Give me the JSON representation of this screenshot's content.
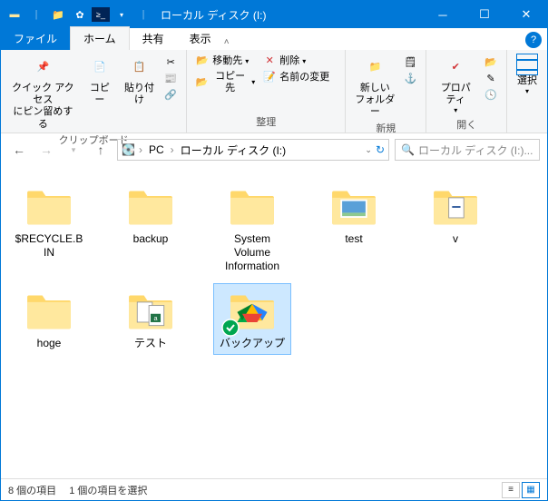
{
  "titlebar": {
    "title": "ローカル ディスク (I:)"
  },
  "tabs": {
    "file": "ファイル",
    "home": "ホーム",
    "share": "共有",
    "view": "表示"
  },
  "ribbon": {
    "clipboard": {
      "pin": "クイック アクセス\nにピン留めする",
      "copy": "コピー",
      "paste": "貼り付け",
      "label": "クリップボード"
    },
    "organize": {
      "moveto": "移動先",
      "copyto": "コピー先",
      "delete": "削除",
      "rename": "名前の変更",
      "label": "整理"
    },
    "new": {
      "newfolder": "新しい\nフォルダー",
      "label": "新規"
    },
    "open": {
      "properties": "プロパティ",
      "label": "開く"
    },
    "select": {
      "select": "選択",
      "label": ""
    }
  },
  "address": {
    "pc": "PC",
    "drive": "ローカル ディスク (I:)",
    "search_placeholder": "ローカル ディスク (I:)..."
  },
  "items": [
    {
      "name": "$RECYCLE.BIN",
      "type": "folder"
    },
    {
      "name": "backup",
      "type": "folder"
    },
    {
      "name": "System Volume Information",
      "type": "folder"
    },
    {
      "name": "test",
      "type": "folder-thumb"
    },
    {
      "name": "v",
      "type": "folder-doc"
    },
    {
      "name": "hoge",
      "type": "folder"
    },
    {
      "name": "テスト",
      "type": "folder-xls"
    },
    {
      "name": "バックアップ",
      "type": "folder-gdrive",
      "selected": true
    }
  ],
  "status": {
    "count": "8 個の項目",
    "selected": "1 個の項目を選択"
  }
}
